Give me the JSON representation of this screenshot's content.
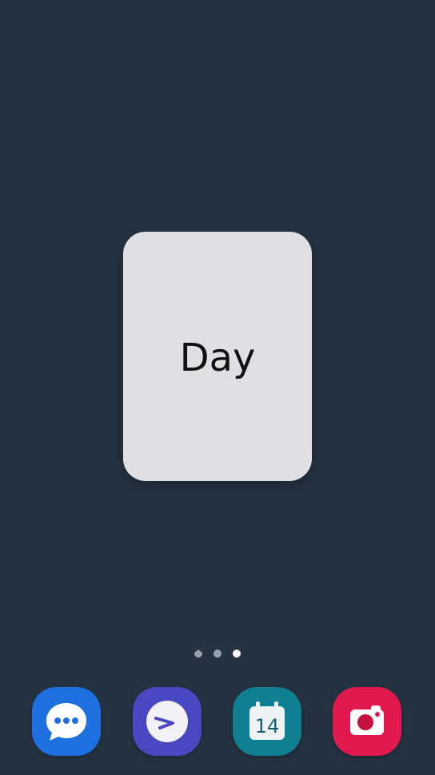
{
  "widget": {
    "label": "Day"
  },
  "page_indicator": {
    "pages": [
      "home",
      "page-2",
      "page-3"
    ],
    "active_index": 2
  },
  "dock": {
    "apps": [
      {
        "icon": "messages-icon",
        "color": "#1e6fe0"
      },
      {
        "icon": "direct-share-icon",
        "color": "#4a47c3"
      },
      {
        "icon": "calendar-icon",
        "color": "#0f7f92",
        "date": "14"
      },
      {
        "icon": "camera-icon",
        "color": "#e2194f"
      }
    ]
  },
  "colors": {
    "wallpaper": "#253241",
    "widget_background": "#e0e0e4"
  }
}
